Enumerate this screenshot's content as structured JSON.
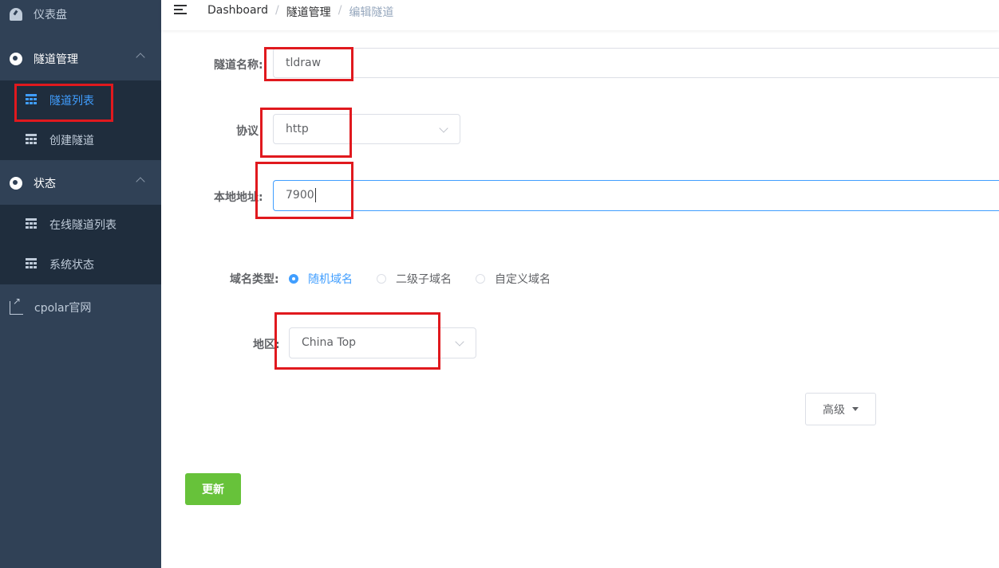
{
  "sidebar": {
    "dashboard": "仪表盘",
    "tunnel_mgmt": "隧道管理",
    "tunnel_list": "隧道列表",
    "create_tunnel": "创建隧道",
    "status": "状态",
    "online_tunnels": "在线隧道列表",
    "system_status": "系统状态",
    "website": "cpolar官网"
  },
  "breadcrumb": [
    "Dashboard",
    "隧道管理",
    "编辑隧道"
  ],
  "form": {
    "name_label": "隧道名称:",
    "name_value": "tldraw",
    "protocol_label": "协议",
    "protocol_value": "http",
    "local_label": "本地地址:",
    "local_value": "7900",
    "domain_type_label": "域名类型:",
    "domain_types": [
      "随机域名",
      "二级子域名",
      "自定义域名"
    ],
    "domain_type_selected": "随机域名",
    "region_label": "地区:",
    "region_value": "China Top",
    "advanced_label": "高级",
    "submit_label": "更新"
  },
  "colors": {
    "sidebar_bg": "#304156",
    "submenu_bg": "#1f2d3d",
    "active": "#409eff",
    "submit": "#67c23a",
    "annotation": "#e0191e"
  }
}
